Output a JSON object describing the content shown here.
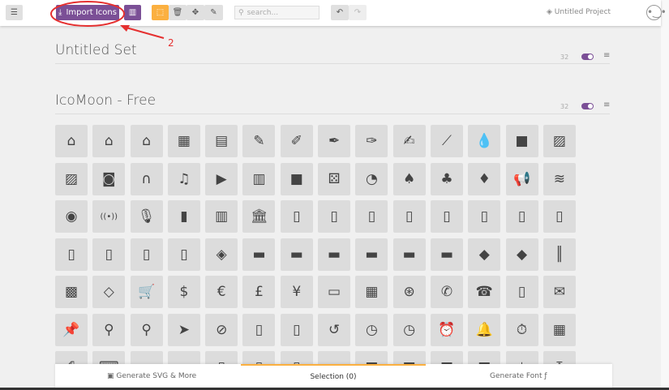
{
  "header": {
    "menu_icon": "hamburger-icon",
    "import_label": "Import Icons",
    "search_placeholder": "search...",
    "project": "Untitled Project"
  },
  "sets": [
    {
      "title": "Untitled Set",
      "count": "32"
    },
    {
      "title": "IcoMoon - Free",
      "count": "32"
    }
  ],
  "annotation": {
    "label": "2",
    "color": "#e53030"
  },
  "icons": [
    "home",
    "home2",
    "home3",
    "office",
    "newspaper",
    "pencil",
    "pencil2",
    "quill",
    "pen",
    "blog",
    "eyedropper",
    "droplet",
    "paint-format",
    "image",
    "images",
    "camera",
    "headphones",
    "music",
    "play",
    "film",
    "video-camera",
    "dice",
    "pacman",
    "spades",
    "clubs",
    "diamonds",
    "bullhorn",
    "connection",
    "podcast",
    "feed",
    "mic",
    "book",
    "books",
    "library",
    "file-text",
    "profile",
    "file-empty",
    "files-empty",
    "file-text2",
    "file-picture",
    "file-music",
    "file-play",
    "file-video",
    "file-zip",
    "copy",
    "paste",
    "stack",
    "folder",
    "folder-open",
    "folder-plus",
    "folder-minus",
    "folder-download",
    "folder-upload",
    "price-tag",
    "price-tags",
    "barcode",
    "qrcode",
    "ticket",
    "cart",
    "coin-dollar",
    "coin-euro",
    "coin-pound",
    "coin-yen",
    "credit-card",
    "calculator",
    "lifebuoy",
    "phone",
    "phone-hang-up",
    "address-book",
    "envelop",
    "pushpin",
    "location",
    "location2",
    "compass",
    "compass2",
    "map",
    "map2",
    "history",
    "clock",
    "clock2",
    "alarm",
    "bell",
    "stopwatch",
    "calendar",
    "printer",
    "keyboard",
    "display",
    "laptop",
    "mobile",
    "mobile2",
    "tablet",
    "tv",
    "drawer",
    "drawer2",
    "box-add",
    "box-remove",
    "download",
    "upload"
  ],
  "footer": {
    "generate_svg": "Generate SVG & More",
    "selection": "Selection (0)",
    "generate_font": "Generate Font"
  },
  "colors": {
    "accent": "#7b4f96",
    "selection": "#fbb040"
  }
}
